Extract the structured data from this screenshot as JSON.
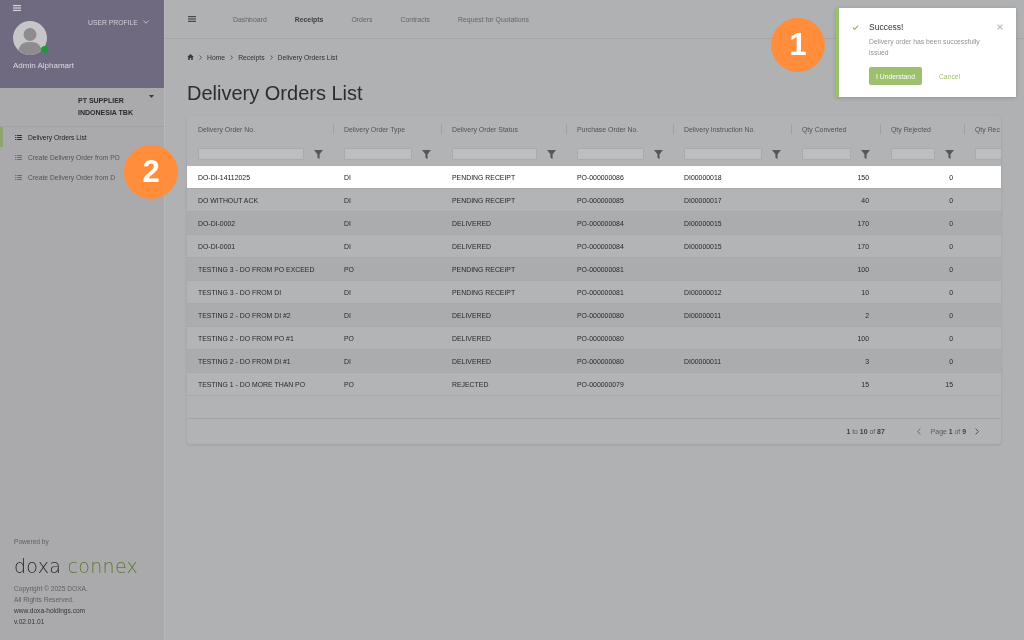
{
  "sidebar": {
    "profile_menu": "USER PROFILE",
    "user": {
      "name": "Admin Alphamart",
      "online": true
    },
    "company": "PT SUPPLIER INDONESIA TBK",
    "items": [
      {
        "label": "Delivery Orders List",
        "selected": true
      },
      {
        "label": "Create Delivery Order from PO",
        "selected": false
      },
      {
        "label": "Create Delivery Order from D",
        "selected": false
      }
    ],
    "footer": {
      "powered_by": "Powered by",
      "logo": {
        "first_word": "doxa",
        "second_word": "connex"
      },
      "copyright": "Copyright © 2025 DOXA.",
      "rights": "All Rights Reserved.",
      "website": "www.doxa-holdings.com",
      "version": "v.02.01.01"
    }
  },
  "nav": {
    "items": [
      {
        "label": "Dashboard",
        "selected": false
      },
      {
        "label": "Receipts",
        "selected": true
      },
      {
        "label": "Orders",
        "selected": false
      },
      {
        "label": "Contracts",
        "selected": false
      },
      {
        "label": "Request for Quotations",
        "selected": false
      }
    ]
  },
  "breadcrumb": [
    "Home",
    "Receipts",
    "Delivery Orders List"
  ],
  "page_title": "Delivery Orders List",
  "table": {
    "columns": [
      "Delivery Order No.",
      "Delivery Order Type",
      "Delivery Order Status",
      "Purchase Order No.",
      "Delivery Instruction No.",
      "Qty Converted",
      "Qty Rejected",
      "Qty Rec"
    ],
    "rows": [
      {
        "highlighted": true,
        "delivery_order_no": "DO-DI-14112025",
        "type": "DI",
        "status": "PENDING RECEIPT",
        "purchase_order_no": "PO-000000086",
        "delivery_instruction_no": "DI00000018",
        "qty_converted": "150",
        "qty_rejected": "0"
      },
      {
        "highlighted": false,
        "delivery_order_no": "DO WITHOUT ACK",
        "type": "DI",
        "status": "PENDING RECEIPT",
        "purchase_order_no": "PO-000000085",
        "delivery_instruction_no": "DI00000017",
        "qty_converted": "40",
        "qty_rejected": "0"
      },
      {
        "highlighted": false,
        "delivery_order_no": "DO-DI-0002",
        "type": "DI",
        "status": "DELIVERED",
        "purchase_order_no": "PO-000000084",
        "delivery_instruction_no": "DI00000015",
        "qty_converted": "170",
        "qty_rejected": "0"
      },
      {
        "highlighted": false,
        "delivery_order_no": "DO-DI-0001",
        "type": "DI",
        "status": "DELIVERED",
        "purchase_order_no": "PO-000000084",
        "delivery_instruction_no": "DI00000015",
        "qty_converted": "170",
        "qty_rejected": "0"
      },
      {
        "highlighted": false,
        "delivery_order_no": "TESTING 3 - DO FROM PO EXCEED",
        "type": "PO",
        "status": "PENDING RECEIPT",
        "purchase_order_no": "PO-000000081",
        "qty_converted": "100",
        "qty_rejected": "0"
      },
      {
        "highlighted": false,
        "delivery_order_no": "TESTING 3 - DO FROM DI",
        "type": "DI",
        "status": "PENDING RECEIPT",
        "purchase_order_no": "PO-000000081",
        "delivery_instruction_no": "DI00000012",
        "qty_converted": "10",
        "qty_rejected": "0"
      },
      {
        "highlighted": false,
        "delivery_order_no": "TESTING 2 - DO FROM DI #2",
        "type": "DI",
        "status": "DELIVERED",
        "purchase_order_no": "PO-000000080",
        "delivery_instruction_no": "DI00000011",
        "qty_converted": "2",
        "qty_rejected": "0"
      },
      {
        "highlighted": false,
        "delivery_order_no": "TESTING 2 - DO FROM PO #1",
        "type": "PO",
        "status": "DELIVERED",
        "purchase_order_no": "PO-000000080",
        "qty_converted": "100",
        "qty_rejected": "0"
      },
      {
        "highlighted": false,
        "delivery_order_no": "TESTING 2 - DO FROM DI #1",
        "type": "DI",
        "status": "DELIVERED",
        "purchase_order_no": "PO-000000080",
        "delivery_instruction_no": "DI00000011",
        "qty_converted": "3",
        "qty_rejected": "0"
      },
      {
        "highlighted": false,
        "delivery_order_no": "TESTING 1 - DO MORE THAN PO",
        "type": "PO",
        "status": "REJECTED",
        "purchase_order_no": "PO-000000079",
        "qty_converted": "15",
        "qty_rejected": "15"
      }
    ],
    "pagination": {
      "range": "**1** to **10** of **87**",
      "page": "Page **1** of **9**"
    }
  },
  "toast": {
    "title": "Success!",
    "message": "Delivery order has been successfully issued",
    "buttons": [
      {
        "label": "I Understand",
        "kind": "primary"
      },
      {
        "label": "Cancel",
        "kind": "link"
      }
    ]
  },
  "callouts": [
    {
      "number": "1"
    },
    {
      "number": "2"
    }
  ]
}
